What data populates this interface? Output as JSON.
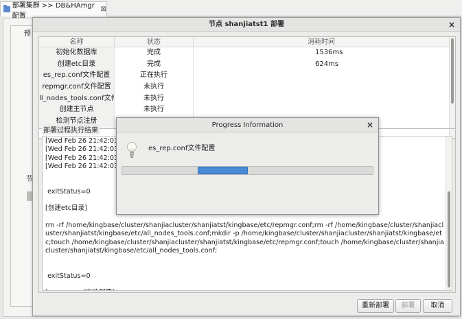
{
  "editor": {
    "tab_title": "部署集群 >> DB&HAmgr配置",
    "tab_close_glyph": "⊠",
    "bg_label_1": "预",
    "bg_label_2": "节"
  },
  "dialog": {
    "title": "节点 shanjiatst1 部署",
    "close_glyph": "×",
    "table": {
      "columns": [
        "名称",
        "状态",
        "消耗时间"
      ],
      "rows": [
        {
          "name": "初始化数据库",
          "status": "完成",
          "time": "1536ms"
        },
        {
          "name": "创建etc目录",
          "status": "完成",
          "time": "624ms"
        },
        {
          "name": "es_rep.conf文件配置",
          "status": "正在执行",
          "time": ""
        },
        {
          "name": "repmgr.conf文件配置",
          "status": "未执行",
          "time": ""
        },
        {
          "name": "all_nodes_tools.conf文件配置",
          "status": "未执行",
          "time": ""
        },
        {
          "name": "创建主节点",
          "status": "未执行",
          "time": ""
        },
        {
          "name": "检测节点注册",
          "status": "",
          "time": ""
        }
      ]
    },
    "log_title": "部署过程执行结果",
    "log_text": "[Wed Feb 26 21:42:03 CST\n[Wed Feb 26 21:42:03 CST\n[Wed Feb 26 21:42:03 CST\n[Wed Feb 26 21:42:03 CST\n\n\n exitStatus=0\n\n[创建etc目录]\n\nrm -rf /home/kingbase/cluster/shanjiacluster/shanjiatst/kingbase/etc/repmgr.conf;rm -rf /home/kingbase/cluster/shanjiacluster/shanjiatst/kingbase/etc/all_nodes_tools.conf;mkdir -p /home/kingbase/cluster/shanjiacluster/shanjiatst/kingbase/etc;touch /home/kingbase/cluster/shanjiacluster/shanjiatst/kingbase/etc/repmgr.conf;touch /home/kingbase/cluster/shanjiacluster/shanjiatst/kingbase/etc/all_nodes_tools.conf;\n\n\n exitStatus=0\n\n[es_rep.conf文件配置]",
    "buttons": {
      "redeploy": "重新部署",
      "deploy": "部署",
      "cancel": "取消"
    }
  },
  "progress": {
    "title": "Progress Information",
    "close_glyph": "×",
    "message": "es_rep.conf文件配置",
    "icon": "lightbulb-icon",
    "fill_fraction": 0.2,
    "fill_start_fraction": 0.3,
    "bar_color": "#4a8bd8"
  }
}
